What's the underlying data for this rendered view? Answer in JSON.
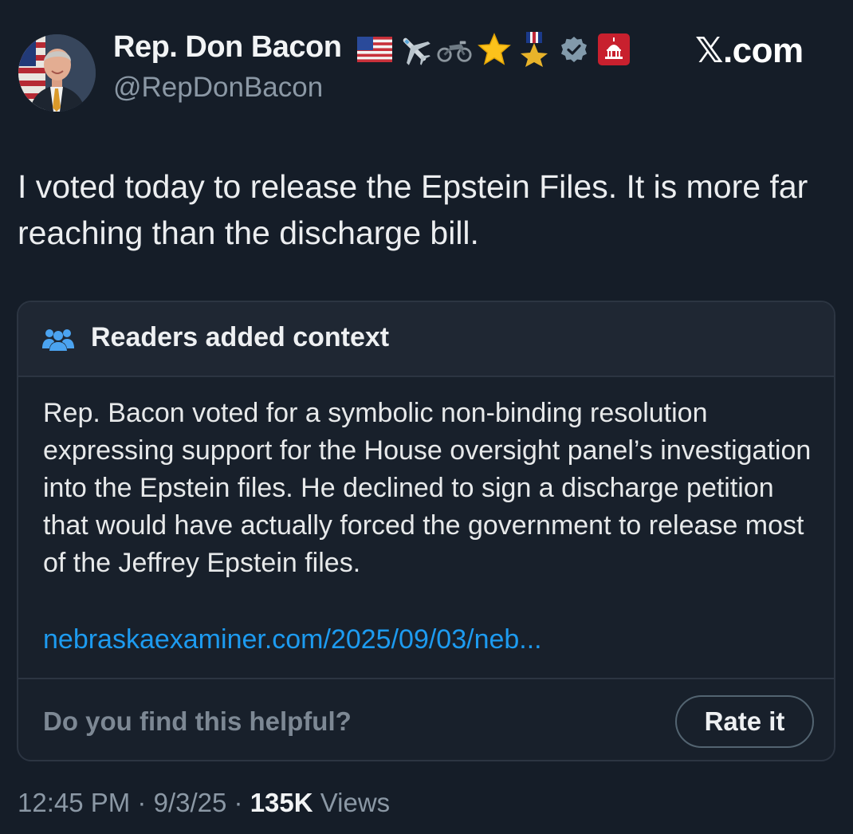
{
  "header": {
    "display_name": "Rep. Don Bacon",
    "handle": "@RepDonBacon",
    "site_logo": "𝕏.com",
    "badges": [
      "us-flag-icon",
      "airplane-icon",
      "motorcycle-icon",
      "star-icon",
      "medal-icon",
      "verified-badge-icon",
      "capitol-affiliation-icon"
    ]
  },
  "tweet": {
    "text": "I voted today to release the Epstein Files. It is more far reaching than the discharge bill."
  },
  "community_note": {
    "title": "Readers added context",
    "body": "Rep. Bacon voted for a symbolic non-binding resolution expressing support for the House oversight panel’s investigation into the Epstein files. He declined to sign a discharge petition that would have actually forced the government to release most of the Jeffrey Epstein files.",
    "link": "nebraskaexaminer.com/2025/09/03/neb...",
    "question": "Do you find this helpful?",
    "rate_button": "Rate it"
  },
  "meta": {
    "time": "12:45 PM",
    "date": "9/3/25",
    "separator": "·",
    "views_count": "135K",
    "views_label": "Views"
  },
  "colors": {
    "background": "#151d28",
    "card": "#18202b",
    "card_header": "#1f2733",
    "link": "#1d9bf0",
    "verified": "#829aab",
    "muted_text": "#8b98a5"
  }
}
